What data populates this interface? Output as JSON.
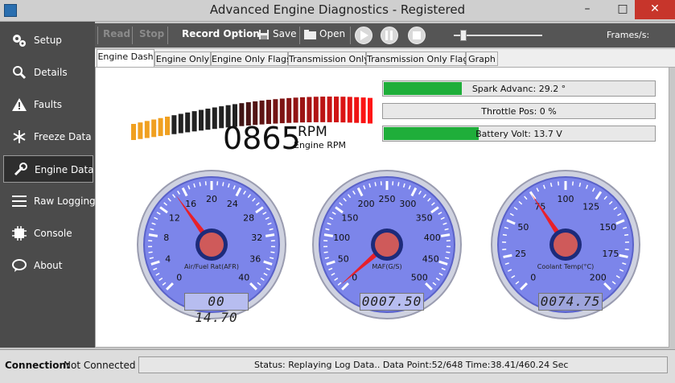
{
  "window": {
    "title": "Advanced Engine Diagnostics - Registered",
    "minimize": "–",
    "maximize": "□",
    "close": "✕"
  },
  "sidebar": {
    "items": [
      {
        "label": "Setup",
        "icon": "gears-icon"
      },
      {
        "label": "Details",
        "icon": "magnifier-icon"
      },
      {
        "label": "Faults",
        "icon": "warning-icon"
      },
      {
        "label": "Freeze Data",
        "icon": "snowflake-icon"
      },
      {
        "label": "Engine Data",
        "icon": "wrench-icon",
        "active": true
      },
      {
        "label": "Raw Logging",
        "icon": "hamburger-icon"
      },
      {
        "label": "Console",
        "icon": "chip-icon"
      },
      {
        "label": "About",
        "icon": "speech-bubble-icon"
      }
    ]
  },
  "toolbar": {
    "read": "Read",
    "stop": "Stop",
    "record_options": "Record Options:",
    "save": "Save",
    "open": "Open",
    "frames": "Frames/s:"
  },
  "tabs": [
    "Engine Dash",
    "Engine Only",
    "Engine Only Flags",
    "Transmission Only",
    "Transmission Only Flags",
    "Graph"
  ],
  "dash": {
    "rpm_value": "0865",
    "rpm_unit": "RPM",
    "rpm_label": "Engine RPM",
    "rpm_level": 0.17
  },
  "bars": [
    {
      "text": "Spark Advanc: 29.2 °",
      "fill": 0.29
    },
    {
      "text": "Throttle Pos: 0 %",
      "fill": 0.0
    },
    {
      "text": "Battery Volt: 13.7 V",
      "fill": 0.35
    }
  ],
  "gauges": [
    {
      "label": "Air/Fuel Rat(AFR)",
      "ticks": [
        "0",
        "4",
        "8",
        "12",
        "16",
        "20",
        "24",
        "28",
        "32",
        "36",
        "40"
      ],
      "min": 0,
      "max": 40,
      "value": 14.7,
      "readout": "00 14.70"
    },
    {
      "label": "MAF(G/S)",
      "ticks": [
        "0",
        "50",
        "100",
        "150",
        "200",
        "250",
        "300",
        "350",
        "400",
        "450",
        "500"
      ],
      "min": 0,
      "max": 500,
      "value": 7.5,
      "readout": "0007.50"
    },
    {
      "label": "Coolant Temp(°C)",
      "ticks": [
        "0",
        "25",
        "50",
        "75",
        "100",
        "125",
        "150",
        "175",
        "200"
      ],
      "min": 0,
      "max": 200,
      "value": 74.75,
      "readout": "0074.75"
    }
  ],
  "status": {
    "connection_label": "Connection:",
    "connection_value": "Not Connected",
    "text": "Status: Replaying Log Data..  Data Point:52/648    Time:38.41/460.24 Sec"
  }
}
